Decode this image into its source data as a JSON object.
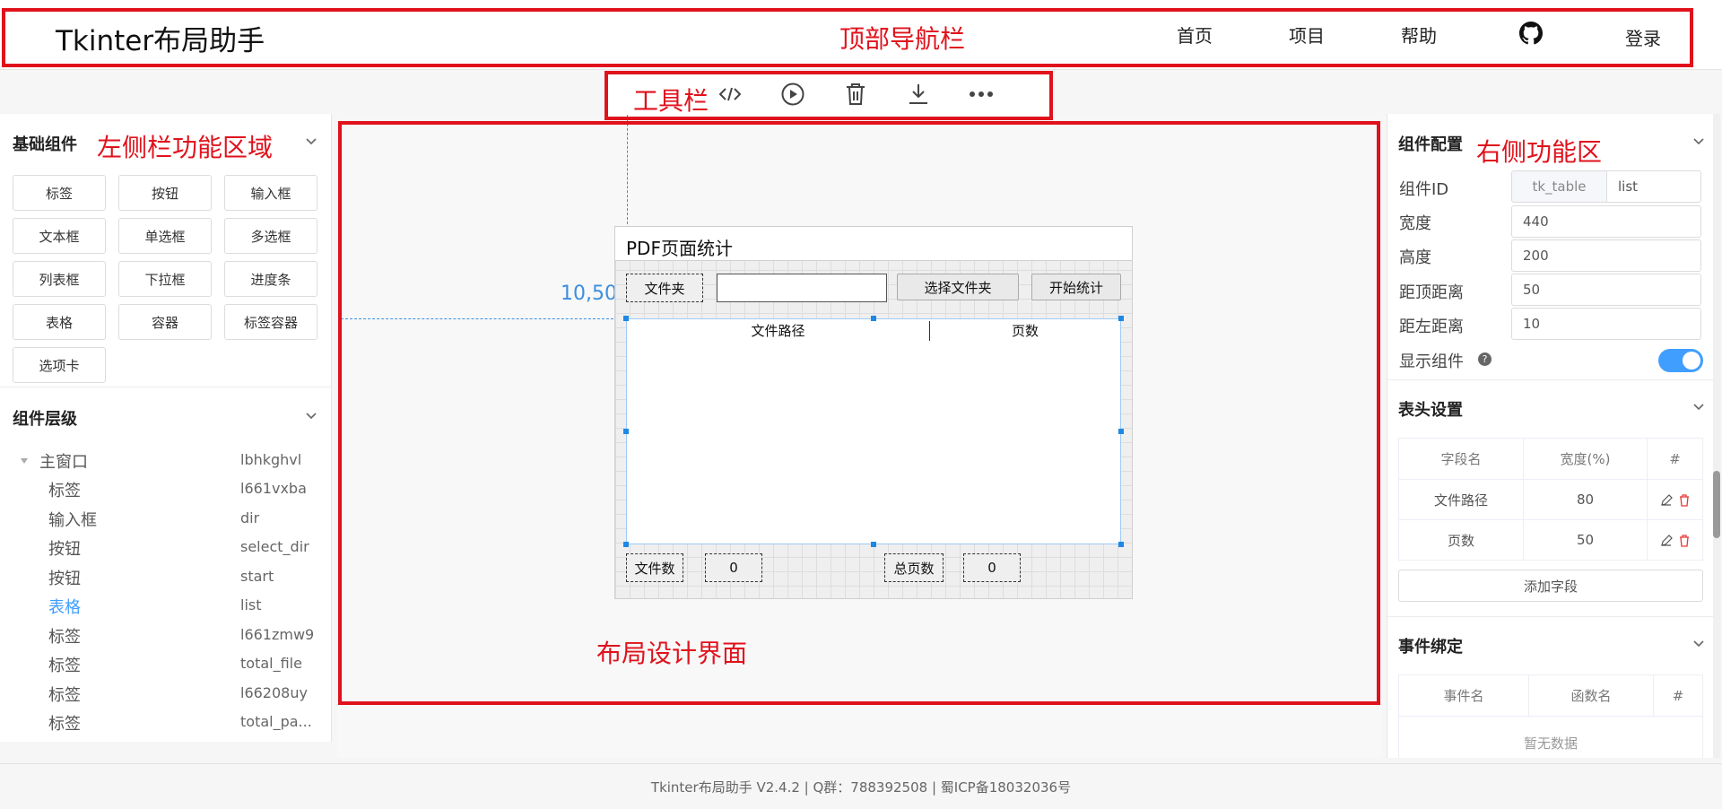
{
  "topbar": {
    "app_title": "Tkinter布局助手",
    "nav": [
      "首页",
      "项目",
      "帮助"
    ],
    "login": "登录",
    "github_icon": "github-icon"
  },
  "annotations": {
    "topbar": "顶部导航栏",
    "toolbar": "工具栏",
    "left": "左侧栏功能区域",
    "right": "右侧功能区",
    "canvas": "布局设计界面"
  },
  "toolbar": {
    "icons": [
      "code-icon",
      "play-icon",
      "trash-icon",
      "download-icon",
      "more-icon"
    ]
  },
  "left_panel": {
    "basic_title": "基础组件",
    "components": [
      "标签",
      "按钮",
      "输入框",
      "文本框",
      "单选框",
      "多选框",
      "列表框",
      "下拉框",
      "进度条",
      "表格",
      "容器",
      "标签容器",
      "选项卡"
    ],
    "hierarchy_title": "组件层级",
    "tree": [
      {
        "name": "主窗口",
        "id": "lbhkghvl"
      },
      {
        "name": "标签",
        "id": "l661vxba"
      },
      {
        "name": "输入框",
        "id": "dir"
      },
      {
        "name": "按钮",
        "id": "select_dir"
      },
      {
        "name": "按钮",
        "id": "start"
      },
      {
        "name": "表格",
        "id": "list"
      },
      {
        "name": "标签",
        "id": "l661zmw9"
      },
      {
        "name": "标签",
        "id": "total_file"
      },
      {
        "name": "标签",
        "id": "l66208uy"
      },
      {
        "name": "标签",
        "id": "total_pa..."
      }
    ],
    "selected_index": 5
  },
  "canvas": {
    "coord_readout": "10,50",
    "window_title": "PDF页面统计",
    "label_folder": "文件夹",
    "btn_select": "选择文件夹",
    "btn_start": "开始统计",
    "table_headers": [
      "文件路径",
      "页数"
    ],
    "label_file_count": "文件数",
    "file_count_value": "0",
    "label_total_pages": "总页数",
    "total_pages_value": "0"
  },
  "right_panel": {
    "config_title": "组件配置",
    "fields": {
      "id_label": "组件ID",
      "id_prefix": "tk_table",
      "id_value": "list",
      "width_label": "宽度",
      "width_value": "440",
      "height_label": "高度",
      "height_value": "200",
      "top_label": "距顶距离",
      "top_value": "50",
      "left_label": "距左距离",
      "left_value": "10",
      "show_label": "显示组件",
      "show_enabled": true
    },
    "header_title": "表头设置",
    "header_cols": [
      "字段名",
      "宽度(%)",
      "#"
    ],
    "header_rows": [
      {
        "field": "文件路径",
        "width": "80"
      },
      {
        "field": "页数",
        "width": "50"
      }
    ],
    "add_field": "添加字段",
    "event_title": "事件绑定",
    "event_cols": [
      "事件名",
      "函数名",
      "#"
    ],
    "event_empty": "暂无数据"
  },
  "footer": {
    "text": "Tkinter布局助手 V2.4.2 | Q群：788392508 | 蜀ICP备18032036号"
  },
  "colors": {
    "annotation": "#e0121c",
    "accent": "#409eff",
    "selection": "#1e88e5"
  }
}
